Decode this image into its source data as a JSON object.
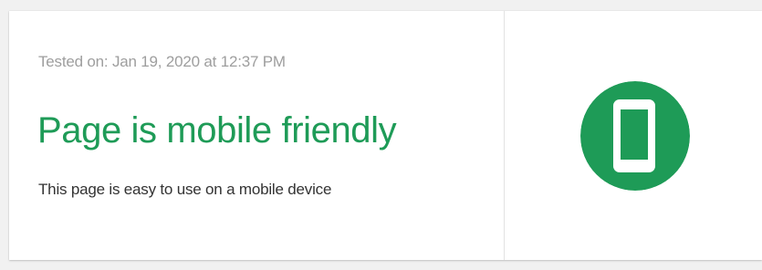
{
  "result": {
    "tested_on": "Tested on: Jan 19, 2020 at 12:37 PM",
    "title": "Page is mobile friendly",
    "description": "This page is easy to use on a mobile device",
    "status_icon": "mobile-phone-icon",
    "accent_color": "#1e9b57"
  }
}
